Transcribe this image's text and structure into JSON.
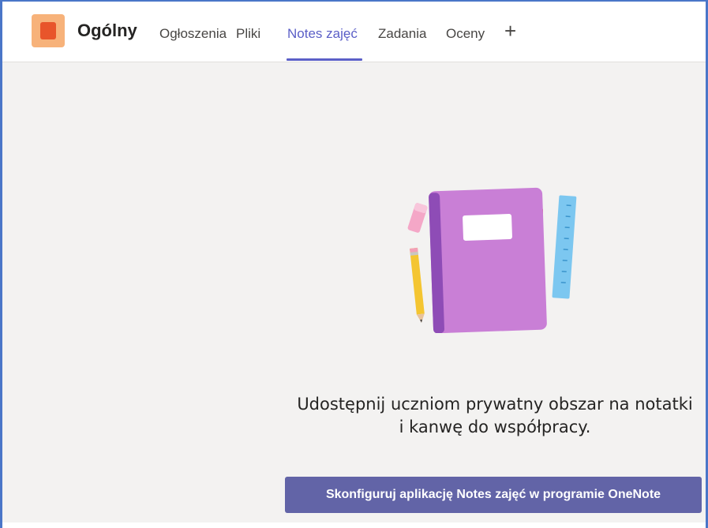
{
  "header": {
    "channel_title": "Ogólny",
    "team_avatar_icon": "team-avatar-icon",
    "tabs": [
      {
        "label": "Ogłoszenia",
        "active": false
      },
      {
        "label": "Pliki",
        "active": false
      },
      {
        "label": "Notes zajęć",
        "active": true
      },
      {
        "label": "Zadania",
        "active": false
      },
      {
        "label": "Oceny",
        "active": false
      }
    ],
    "add_tab_label": "+"
  },
  "main": {
    "illustration_icon": "notebook-pencil-ruler-illustration",
    "message_line1": "Udostępnij uczniom prywatny obszar na notatki",
    "message_line2": "i kanwę do współpracy.",
    "setup_button_label": "Skonfiguruj aplikację Notes zajęć w programie OneNote"
  },
  "colors": {
    "accent": "#6264a7",
    "active_tab": "#5b5fc7",
    "frame": "#4a76c8",
    "background": "#f3f2f1"
  }
}
